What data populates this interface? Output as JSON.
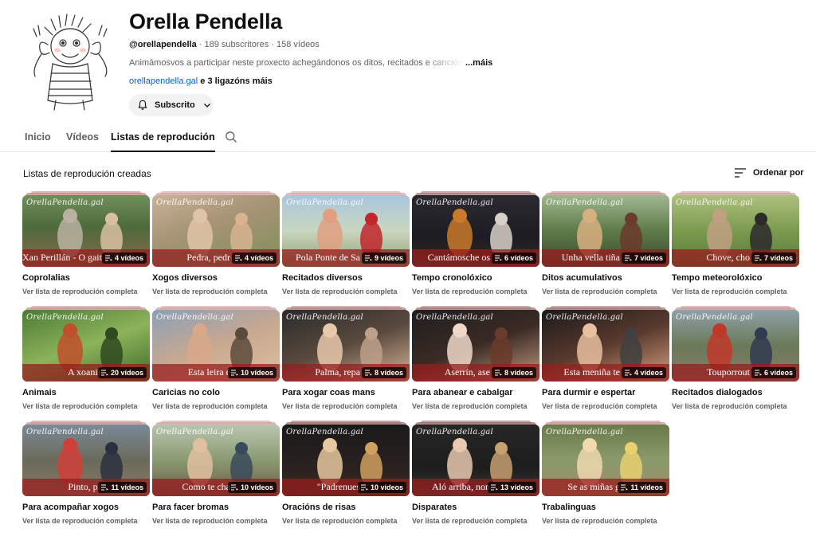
{
  "channel": {
    "name": "Orella Pendella",
    "handle": "@orellapendella",
    "subscribers": "189 subscritores",
    "videos": "158 vídeos",
    "separator": " · ",
    "description": "Animámosvos a participar neste proxecto achegándonos os ditos, recitados e cancións que",
    "more_label": "...máis",
    "link_url": "orellapendella.gal",
    "link_more": " e 3 ligazóns máis",
    "subscribe_label": "Subscrito"
  },
  "tabs": [
    {
      "label": "Inicio",
      "active": false
    },
    {
      "label": "Vídeos",
      "active": false
    },
    {
      "label": "Listas de reprodución",
      "active": true
    }
  ],
  "section": {
    "title": "Listas de reprodución creadas",
    "sort_label": "Ordenar por"
  },
  "playlists": [
    {
      "title": "Coprolalias",
      "count": "4 vídeos",
      "overlay": "Xan Perillán - O gaiteiro de Santiago",
      "link": "Ver lista de reprodución completa",
      "theme": "dance"
    },
    {
      "title": "Xogos diversos",
      "count": "4 vídeos",
      "overlay": "Pedra, pedr",
      "link": "Ver lista de reprodución completa",
      "theme": "hands"
    },
    {
      "title": "Recitados diversos",
      "count": "9 vídeos",
      "overlay": "Pola Ponte de Sa",
      "link": "Ver lista de reprodución completa",
      "theme": "boy"
    },
    {
      "title": "Tempo cronolóxico",
      "count": "6 vídeos",
      "overlay": "Cantámosche os",
      "link": "Ver lista de reprodución completa",
      "theme": "stage"
    },
    {
      "title": "Ditos acumulativos",
      "count": "7 vídeos",
      "overlay": "Unha vella tiña",
      "link": "Ver lista de reprodución completa",
      "theme": "duo"
    },
    {
      "title": "Tempo meteorolóxico",
      "count": "7 vídeos",
      "overlay": "Chove, cho",
      "link": "Ver lista de reprodución completa",
      "theme": "field"
    },
    {
      "title": "Animais",
      "count": "20 vídeos",
      "overlay": "A xoanii",
      "link": "Ver lista de reprodución completa",
      "theme": "bug"
    },
    {
      "title": "Caricias no colo",
      "count": "10 vídeos",
      "overlay": "Esta leira é",
      "link": "Ver lista de reprodución completa",
      "theme": "family"
    },
    {
      "title": "Para xogar coas mans",
      "count": "8 vídeos",
      "overlay": "Palma, repa",
      "link": "Ver lista de reprodución completa",
      "theme": "palms"
    },
    {
      "title": "Para abanear e cabalgar",
      "count": "8 vídeos",
      "overlay": "Aserrín, ase",
      "link": "Ver lista de reprodución completa",
      "theme": "baby"
    },
    {
      "title": "Para durmir e espertar",
      "count": "4 vídeos",
      "overlay": "Esta meniña te",
      "link": "Ver lista de reprodución completa",
      "theme": "sleep"
    },
    {
      "title": "Recitados dialogados",
      "count": "6 vídeos",
      "overlay": "Touporrout",
      "link": "Ver lista de reprodución completa",
      "theme": "kids"
    },
    {
      "title": "Para acompañar xogos",
      "count": "11 vídeos",
      "overlay": "Pinto, pi",
      "link": "Ver lista de reprodución completa",
      "theme": "group"
    },
    {
      "title": "Para facer bromas",
      "count": "10 vídeos",
      "overlay": "Como te cha",
      "link": "Ver lista de reprodución completa",
      "theme": "prank"
    },
    {
      "title": "Oracións de risas",
      "count": "10 vídeos",
      "overlay": "\"Padrenues",
      "link": "Ver lista de reprodución completa",
      "theme": "clowns"
    },
    {
      "title": "Disparates",
      "count": "13 vídeos",
      "overlay": "Aló arriba, non",
      "link": "Ver lista de reprodución completa",
      "theme": "woman"
    },
    {
      "title": "Trabalinguas",
      "count": "11 vídeos",
      "overlay": "Se as miñas g",
      "link": "Ver lista de reprodución completa",
      "theme": "garden"
    }
  ],
  "watermark": "OrellaPendella.gal"
}
